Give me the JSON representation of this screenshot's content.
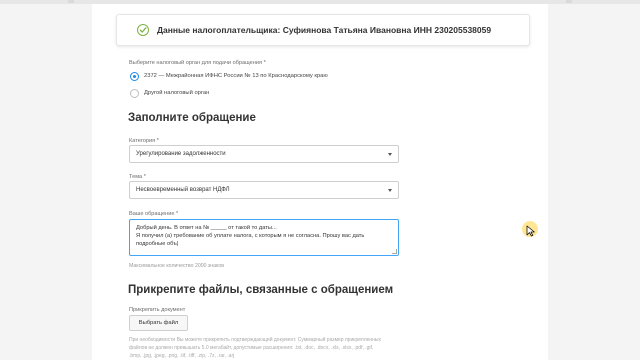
{
  "taxpayer_banner": {
    "text": "Данные налогоплательщика: Суфиянова Татьяна Ивановна ИНН 230205538059"
  },
  "tax_authority": {
    "label": "Выберите налоговый орган для подачи обращения *",
    "options": [
      {
        "text": "2372 — Межрайонная ИФНС России № 13 по Краснодарскому краю",
        "selected": true
      },
      {
        "text": "Другой налоговый орган",
        "selected": false
      }
    ]
  },
  "appeal_section": {
    "title": "Заполните обращение"
  },
  "category": {
    "label": "Категория *",
    "value": "Урегулирование задолженности"
  },
  "topic": {
    "label": "Тема *",
    "value": "Несвоевременный возврат НДФЛ"
  },
  "message": {
    "label": "Ваше обращение *",
    "lines": [
      "Добрый день. В ответ на № _____ от такой то даты...",
      "Я получил (а) требование об уплате налога, с которым я не согласна. Прошу вас дать",
      "подробные объ|"
    ],
    "max_length_hint": "Максимальное количество 2000 знаков"
  },
  "attach_section": {
    "title": "Прикрепите файлы, связанные с обращением",
    "label": "Прикрепить документ",
    "button_label": "Выбрать файл",
    "note_lines": [
      "При необходимости Вы можете прикрепить подтверждающий документ. Суммарный размер прикрепленных",
      "файлов не должен превышать 5.0 мегабайт, допустимые расширения: .txt, .doc, .docx, .xls, .xlsx, .pdf, .gif,",
      ".bmp, .jpg, .jpeg, .png, .tif, .tiff, .zip, .7z, .rar, .arj"
    ]
  },
  "colors": {
    "accent": "#1e88e5",
    "success": "#7cb342",
    "focus_border": "#42a5f5"
  }
}
